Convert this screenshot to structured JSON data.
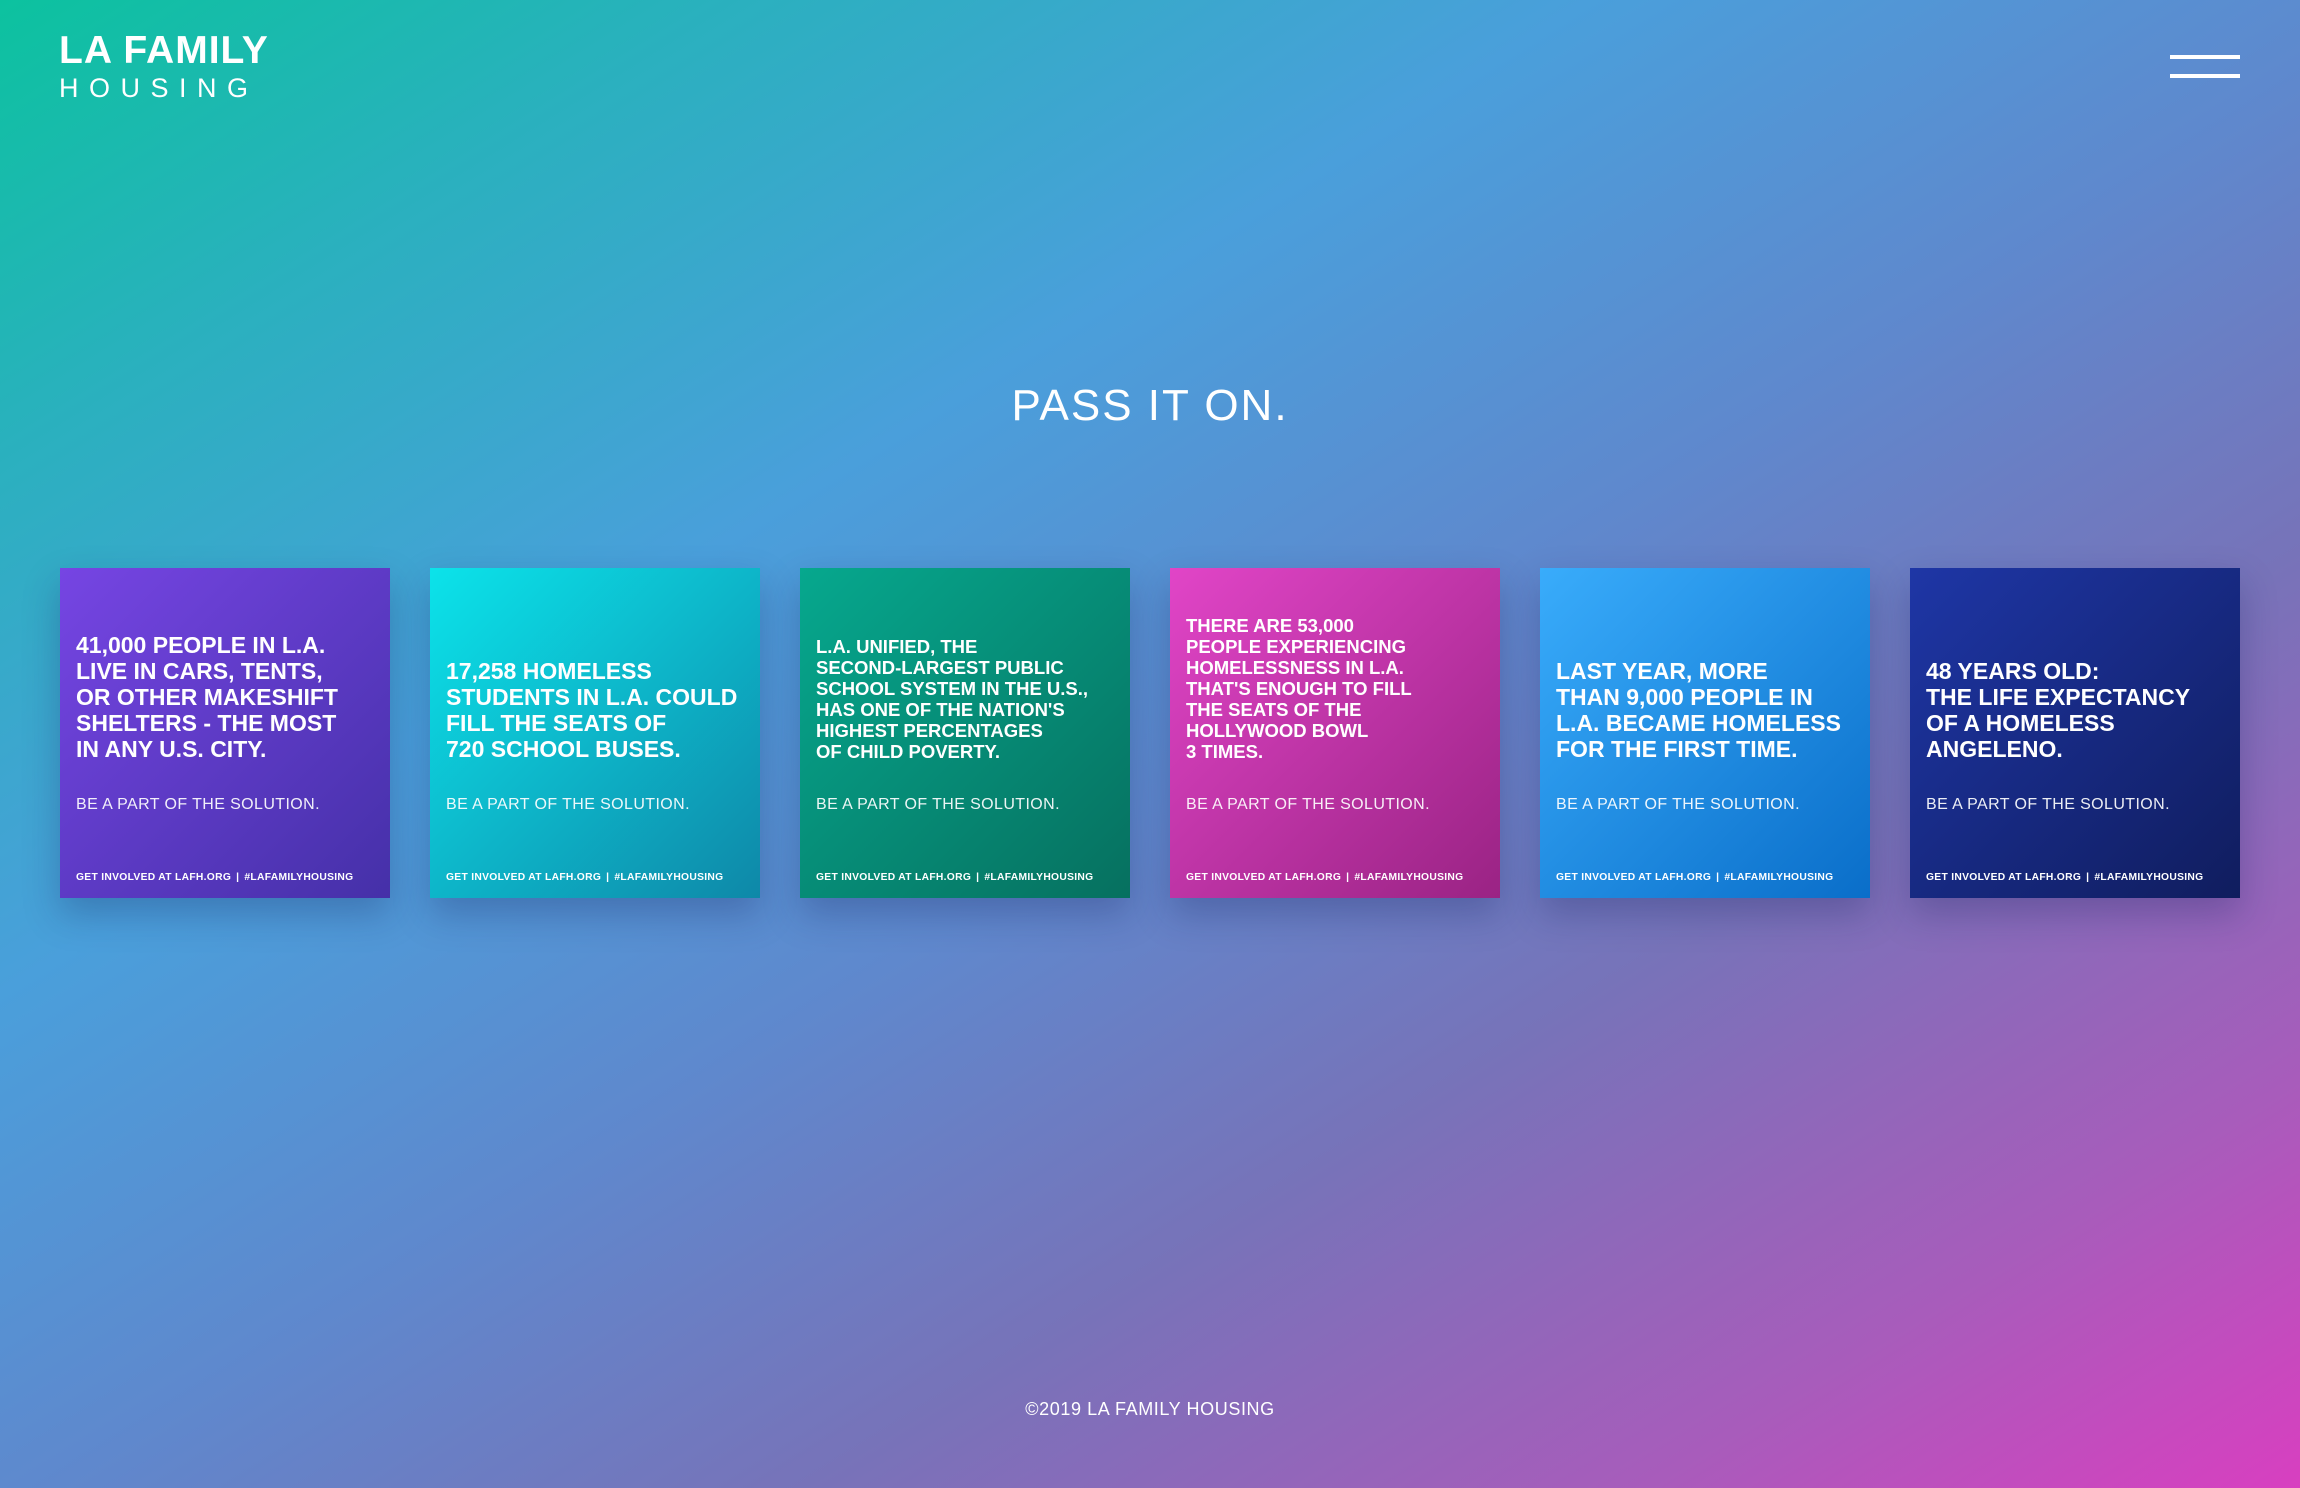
{
  "header": {
    "logo_line1": "LA FAMILY",
    "logo_line2": "HOUSING",
    "menu_icon": "hamburger-menu-icon"
  },
  "main": {
    "title": "PASS IT ON.",
    "cards": [
      {
        "headline": "41,000 PEOPLE IN L.A.\nLIVE IN CARS, TENTS,\nOR OTHER MAKESHIFT\nSHELTERS - THE MOST\nIN ANY U.S. CITY.",
        "subtitle": "BE A PART OF THE SOLUTION.",
        "footer_left": "GET INVOLVED AT LAFH.ORG",
        "footer_separator": "|",
        "footer_right": "#LAFAMILYHOUSING",
        "gradient": [
          "#7645e3",
          "#4530a8"
        ]
      },
      {
        "headline": "17,258 HOMELESS\nSTUDENTS IN L.A. COULD\nFILL THE SEATS OF\n720 SCHOOL BUSES.",
        "subtitle": "BE A PART OF THE SOLUTION.",
        "footer_left": "GET INVOLVED AT LAFH.ORG",
        "footer_separator": "|",
        "footer_right": "#LAFAMILYHOUSING",
        "gradient": [
          "#0ce3ea",
          "#0e88a8"
        ]
      },
      {
        "headline": "L.A. UNIFIED, THE\nSECOND-LARGEST PUBLIC\nSCHOOL SYSTEM IN THE U.S.,\nHAS ONE OF THE NATION'S\nHIGHEST PERCENTAGES\nOF CHILD POVERTY.",
        "subtitle": "BE A PART OF THE SOLUTION.",
        "footer_left": "GET INVOLVED AT LAFH.ORG",
        "footer_separator": "|",
        "footer_right": "#LAFAMILYHOUSING",
        "gradient": [
          "#06a88e",
          "#06705f"
        ]
      },
      {
        "headline": "THERE ARE 53,000\nPEOPLE EXPERIENCING\nHOMELESSNESS IN L.A.\nTHAT'S ENOUGH TO FILL\nTHE SEATS OF THE\nHOLLYWOOD BOWL\n3 TIMES.",
        "subtitle": "BE A PART OF THE SOLUTION.",
        "footer_left": "GET INVOLVED AT LAFH.ORG",
        "footer_separator": "|",
        "footer_right": "#LAFAMILYHOUSING",
        "gradient": [
          "#e145c7",
          "#9a2384"
        ]
      },
      {
        "headline": "LAST YEAR, MORE\nTHAN 9,000 PEOPLE IN\nL.A. BECAME HOMELESS\nFOR THE FIRST TIME.",
        "subtitle": "BE A PART OF THE SOLUTION.",
        "footer_left": "GET INVOLVED AT LAFH.ORG",
        "footer_separator": "|",
        "footer_right": "#LAFAMILYHOUSING",
        "gradient": [
          "#39acfb",
          "#0a6ec9"
        ]
      },
      {
        "headline": "48 YEARS OLD:\nTHE LIFE EXPECTANCY\nOF A HOMELESS\nANGELENO.",
        "subtitle": "BE A PART OF THE SOLUTION.",
        "footer_left": "GET INVOLVED AT LAFH.ORG",
        "footer_separator": "|",
        "footer_right": "#LAFAMILYHOUSING",
        "gradient": [
          "#1e36a6",
          "#101d5e"
        ]
      }
    ]
  },
  "footer": {
    "copyright": "©2019 LA FAMILY HOUSING"
  }
}
